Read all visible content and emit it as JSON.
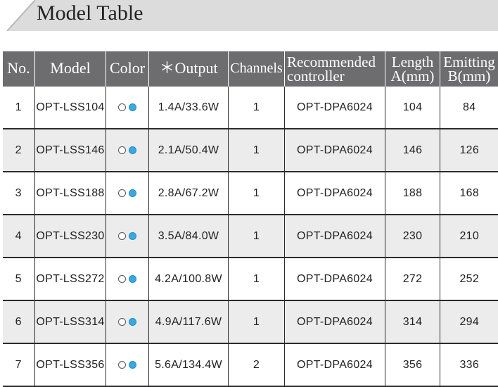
{
  "header": {
    "title": "Model Table"
  },
  "table": {
    "columns": {
      "no": "No.",
      "model": "Model",
      "color": "Color",
      "output": "＊Output",
      "channels": "Channels",
      "controller_line1": "Recommended",
      "controller_line2": "controller",
      "length_line1": "Length",
      "length_line2": "A(mm)",
      "emitting_line1": "Emitting",
      "emitting_line2": "B(mm)"
    },
    "color_icons": {
      "first": "white-circle-icon",
      "second": "blue-circle-icon",
      "blue_hex": "#3ea8de"
    },
    "rows": [
      {
        "no": "1",
        "model": "OPT-LSS104",
        "output": "1.4A/33.6W",
        "channels": "1",
        "controller": "OPT-DPA6024",
        "length": "104",
        "emitting": "84"
      },
      {
        "no": "2",
        "model": "OPT-LSS146",
        "output": "2.1A/50.4W",
        "channels": "1",
        "controller": "OPT-DPA6024",
        "length": "146",
        "emitting": "126"
      },
      {
        "no": "3",
        "model": "OPT-LSS188",
        "output": "2.8A/67.2W",
        "channels": "1",
        "controller": "OPT-DPA6024",
        "length": "188",
        "emitting": "168"
      },
      {
        "no": "4",
        "model": "OPT-LSS230",
        "output": "3.5A/84.0W",
        "channels": "1",
        "controller": "OPT-DPA6024",
        "length": "230",
        "emitting": "210"
      },
      {
        "no": "5",
        "model": "OPT-LSS272",
        "output": "4.2A/100.8W",
        "channels": "1",
        "controller": "OPT-DPA6024",
        "length": "272",
        "emitting": "252"
      },
      {
        "no": "6",
        "model": "OPT-LSS314",
        "output": "4.9A/117.6W",
        "channels": "1",
        "controller": "OPT-DPA6024",
        "length": "314",
        "emitting": "294"
      },
      {
        "no": "7",
        "model": "OPT-LSS356",
        "output": "5.6A/134.4W",
        "channels": "2",
        "controller": "OPT-DPA6024",
        "length": "356",
        "emitting": "336"
      }
    ]
  }
}
